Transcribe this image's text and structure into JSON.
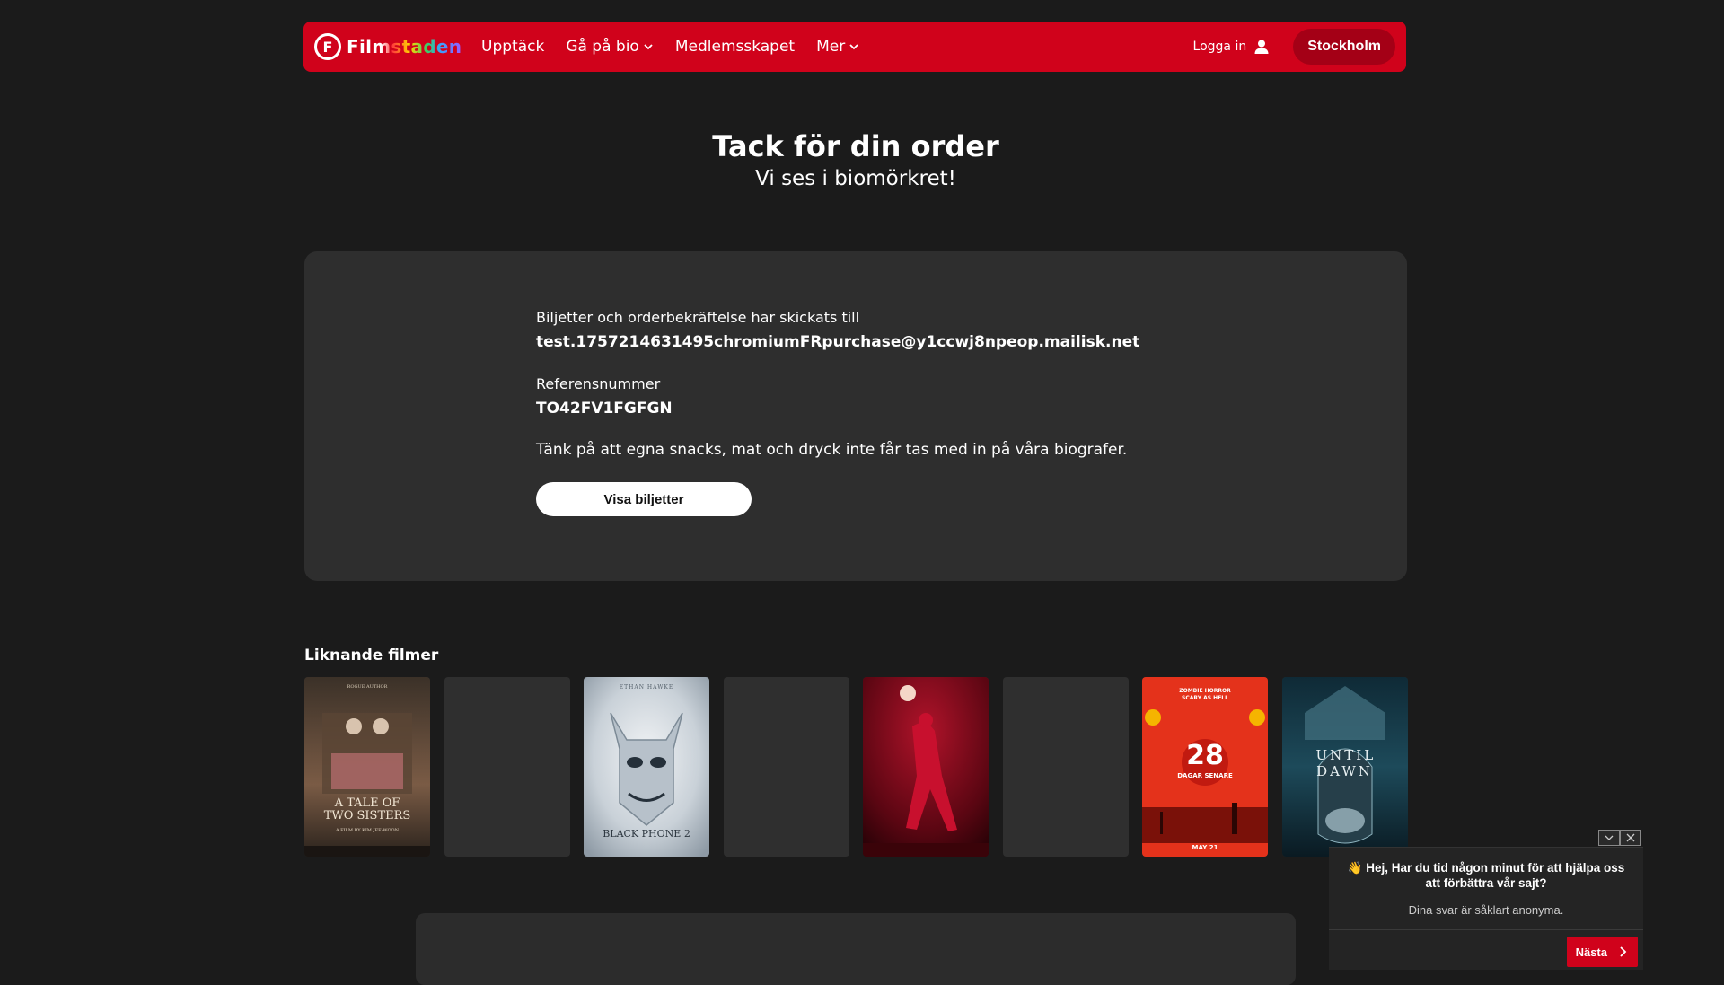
{
  "header": {
    "logo_letter": "F",
    "logo_text": "Filmstaden",
    "nav": [
      {
        "label": "Upptäck",
        "has_dropdown": false
      },
      {
        "label": "Gå på bio",
        "has_dropdown": true
      },
      {
        "label": "Medlemsskapet",
        "has_dropdown": false
      },
      {
        "label": "Mer",
        "has_dropdown": true
      }
    ],
    "login_label": "Logga in",
    "city_label": "Stockholm"
  },
  "confirmation": {
    "title": "Tack för din order",
    "subtitle": "Vi ses i biomörkret!",
    "sent_label": "Biljetter och orderbekräftelse har skickats till",
    "email": "test.1757214631495chromiumFRpurchase@y1ccwj8npeop.mailisk.net",
    "ref_label": "Referensnummer",
    "ref_number": "TO42FV1FGFGN",
    "snacks_note": "Tänk på att egna snacks, mat och dryck inte får tas med in på våra biografer.",
    "show_tickets_button": "Visa biljetter"
  },
  "similar": {
    "heading": "Liknande filmer",
    "posters": [
      {
        "title": "A TALE OF TWO SISTERS",
        "line2": "A FILM BY KIM JEE-WOON",
        "top": "ROGUE AUTHOR"
      },
      {
        "title": ""
      },
      {
        "title": "BLACK PHONE 2",
        "top": "ETHAN HAWKE"
      },
      {
        "title": ""
      },
      {
        "title": ""
      },
      {
        "title": ""
      },
      {
        "title": "28",
        "line2": "DAGAR SENARE",
        "line3": "MAY 21",
        "top": "ZOMBIE HORROR SCARY AS HELL"
      },
      {
        "title": "UNTIL DAWN"
      }
    ]
  },
  "survey": {
    "question": "👋 Hej, Har du tid någon minut för att hjälpa oss att förbättra vår sajt?",
    "subtext": "Dina svar är såklart anonyma.",
    "next_label": "Nästa"
  },
  "colors": {
    "brand_red": "#d0021b",
    "background": "#1b1b1b",
    "card": "#2e2e2e"
  }
}
